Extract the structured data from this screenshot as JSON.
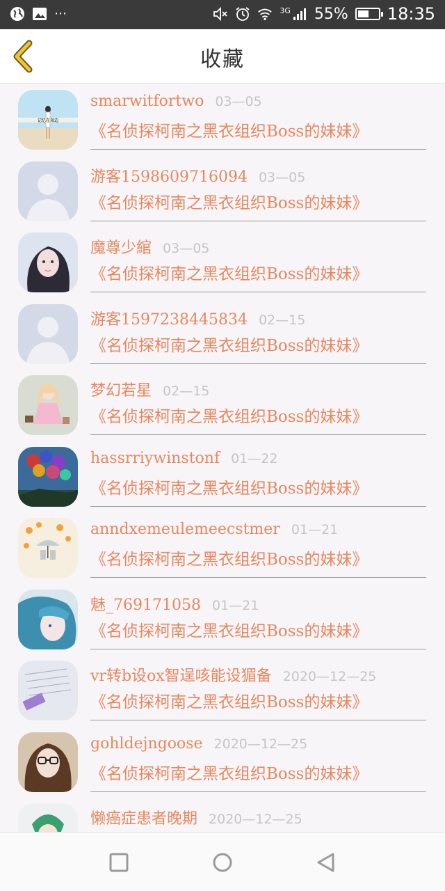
{
  "status_bar": {
    "battery_percent": "55%",
    "battery_level": 0.55,
    "network": "3G",
    "time": "18:35",
    "icons": [
      "globe-icon",
      "image-icon",
      "more-dots-icon",
      "mute-icon",
      "alarm-icon",
      "wifi-icon",
      "signal-icon",
      "battery-icon"
    ]
  },
  "header": {
    "title": "收藏",
    "back_icon": "chevron-left-icon",
    "accent_color": "#e8875f"
  },
  "items": [
    {
      "username": "smarwitfortwo",
      "date": "03—05",
      "novel": "《名侦探柯南之黑衣组织Boss的妹妹》",
      "avatar": "photo-beach"
    },
    {
      "username": "游客1598609716094",
      "date": "03—05",
      "novel": "《名侦探柯南之黑衣组织Boss的妹妹》",
      "avatar": "default-silhouette"
    },
    {
      "username": "魔尊少綰",
      "date": "03—05",
      "novel": "《名侦探柯南之黑衣组织Boss的妹妹》",
      "avatar": "photo-girl-dark-hair"
    },
    {
      "username": "游客1597238445834",
      "date": "02—15",
      "novel": "《名侦探柯南之黑衣组织Boss的妹妹》",
      "avatar": "default-silhouette"
    },
    {
      "username": "梦幻若星",
      "date": "02—15",
      "novel": "《名侦探柯南之黑衣组织Boss的妹妹》",
      "avatar": "anime-pink-girl"
    },
    {
      "username": "hassrriywinstonf",
      "date": "01—22",
      "novel": "《名侦探柯南之黑衣组织Boss的妹妹》",
      "avatar": "photo-balloons"
    },
    {
      "username": "anndxemeulemeecstmer",
      "date": "01—21",
      "novel": "《名侦探柯南之黑衣组织Boss的妹妹》",
      "avatar": "illustration-umbrella"
    },
    {
      "username": "魅_769171058",
      "date": "01—21",
      "novel": "《名侦探柯南之黑衣组织Boss的妹妹》",
      "avatar": "anime-blue-hair"
    },
    {
      "username": "vr转b设ox智逞咳能设猸备",
      "date": "2020—12—25",
      "novel": "《名侦探柯南之黑衣组织Boss的妹妹》",
      "avatar": "photo-notebook"
    },
    {
      "username": "gohldejngoose",
      "date": "2020—12—25",
      "novel": "《名侦探柯南之黑衣组织Boss的妹妹》",
      "avatar": "photo-girl-glasses"
    },
    {
      "username": "懒癌症患者晚期",
      "date": "2020—12—25",
      "novel": "",
      "avatar": "anime-green-hair"
    }
  ],
  "nav_bar": {
    "buttons": [
      "square-recent-apps-icon",
      "circle-home-icon",
      "triangle-back-icon"
    ]
  }
}
